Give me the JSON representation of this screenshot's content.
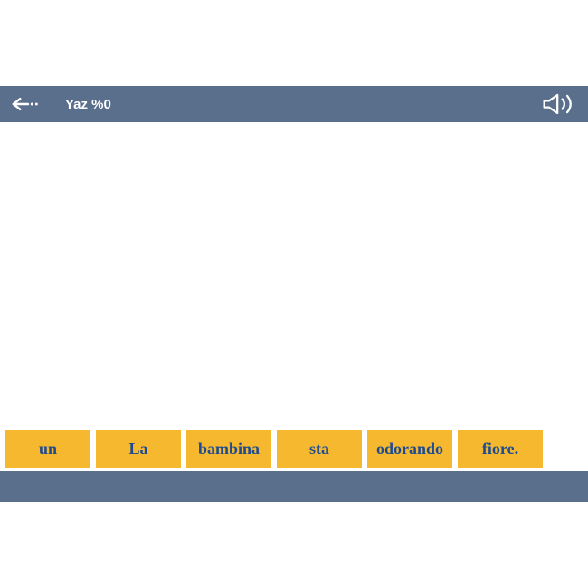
{
  "header": {
    "title": "Yaz %0"
  },
  "words": [
    "un",
    "La",
    "bambina",
    "sta",
    "odorando",
    "fiore."
  ]
}
